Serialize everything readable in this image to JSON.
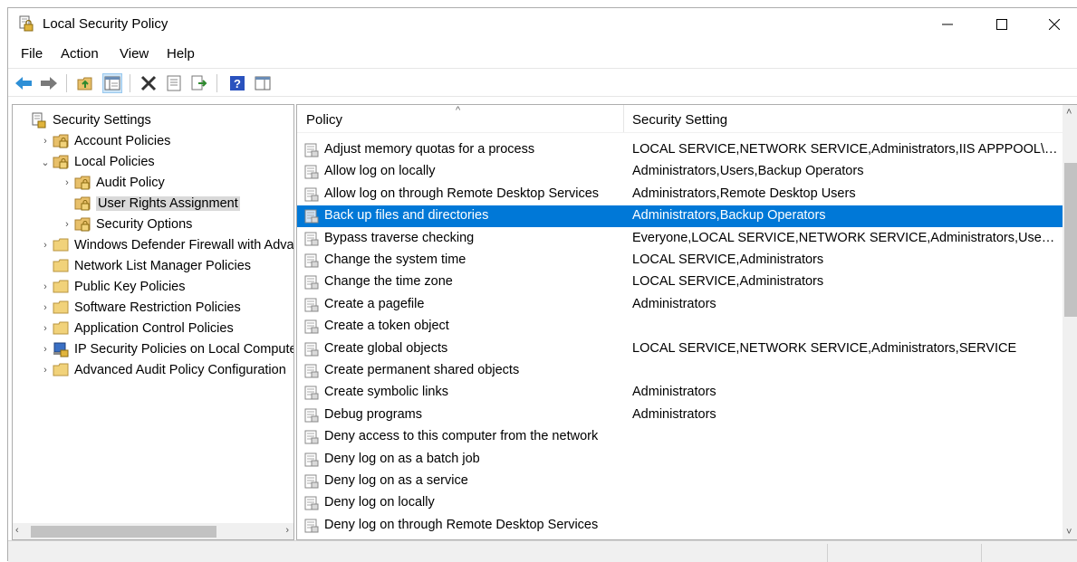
{
  "window": {
    "title": "Local Security Policy"
  },
  "menu": [
    "File",
    "Action",
    "View",
    "Help"
  ],
  "tree": [
    {
      "label": "Security Settings",
      "level": 0,
      "expander": "",
      "icon": "security-settings-icon"
    },
    {
      "label": "Account Policies",
      "level": 1,
      "expander": "›",
      "icon": "folder-lock-icon"
    },
    {
      "label": "Local Policies",
      "level": 1,
      "expander": "⌄",
      "icon": "folder-lock-icon"
    },
    {
      "label": "Audit Policy",
      "level": 2,
      "expander": "›",
      "icon": "folder-lock-icon"
    },
    {
      "label": "User Rights Assignment",
      "level": 2,
      "expander": "",
      "icon": "folder-lock-icon",
      "selected": true
    },
    {
      "label": "Security Options",
      "level": 2,
      "expander": "›",
      "icon": "folder-lock-icon"
    },
    {
      "label": "Windows Defender Firewall with Adva",
      "level": 1,
      "expander": "›",
      "icon": "folder-icon"
    },
    {
      "label": "Network List Manager Policies",
      "level": 1,
      "expander": "",
      "icon": "folder-icon"
    },
    {
      "label": "Public Key Policies",
      "level": 1,
      "expander": "›",
      "icon": "folder-icon"
    },
    {
      "label": "Software Restriction Policies",
      "level": 1,
      "expander": "›",
      "icon": "folder-icon"
    },
    {
      "label": "Application Control Policies",
      "level": 1,
      "expander": "›",
      "icon": "folder-icon"
    },
    {
      "label": "IP Security Policies on Local Compute",
      "level": 1,
      "expander": "›",
      "icon": "ip-security-icon"
    },
    {
      "label": "Advanced Audit Policy Configuration",
      "level": 1,
      "expander": "›",
      "icon": "folder-icon"
    }
  ],
  "columns": {
    "policy": "Policy",
    "setting": "Security Setting"
  },
  "rows": [
    {
      "policy": "Adjust memory quotas for a process",
      "setting": "LOCAL SERVICE,NETWORK SERVICE,Administrators,IIS APPPOOL\\...."
    },
    {
      "policy": "Allow log on locally",
      "setting": "Administrators,Users,Backup Operators"
    },
    {
      "policy": "Allow log on through Remote Desktop Services",
      "setting": "Administrators,Remote Desktop Users"
    },
    {
      "policy": "Back up files and directories",
      "setting": "Administrators,Backup Operators",
      "selected": true
    },
    {
      "policy": "Bypass traverse checking",
      "setting": "Everyone,LOCAL SERVICE,NETWORK SERVICE,Administrators,Users,..."
    },
    {
      "policy": "Change the system time",
      "setting": "LOCAL SERVICE,Administrators"
    },
    {
      "policy": "Change the time zone",
      "setting": "LOCAL SERVICE,Administrators"
    },
    {
      "policy": "Create a pagefile",
      "setting": "Administrators"
    },
    {
      "policy": "Create a token object",
      "setting": ""
    },
    {
      "policy": "Create global objects",
      "setting": "LOCAL SERVICE,NETWORK SERVICE,Administrators,SERVICE"
    },
    {
      "policy": "Create permanent shared objects",
      "setting": ""
    },
    {
      "policy": "Create symbolic links",
      "setting": "Administrators"
    },
    {
      "policy": "Debug programs",
      "setting": "Administrators"
    },
    {
      "policy": "Deny access to this computer from the network",
      "setting": ""
    },
    {
      "policy": "Deny log on as a batch job",
      "setting": ""
    },
    {
      "policy": "Deny log on as a service",
      "setting": ""
    },
    {
      "policy": "Deny log on locally",
      "setting": ""
    },
    {
      "policy": "Deny log on through Remote Desktop Services",
      "setting": ""
    }
  ],
  "colors": {
    "selection": "#0078d7",
    "tree_selection": "#d9d9d9"
  }
}
